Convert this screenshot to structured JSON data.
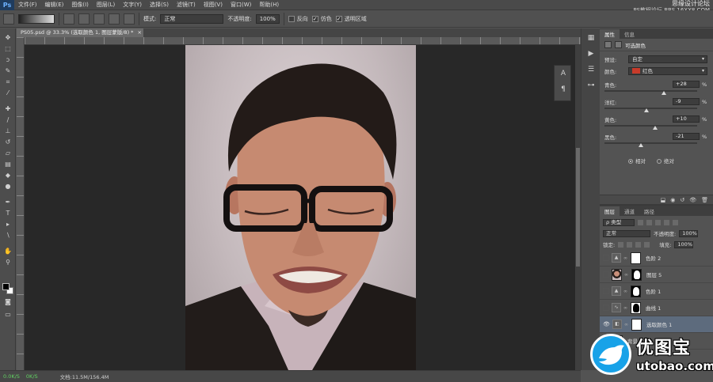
{
  "app": {
    "logo": "Ps"
  },
  "menu": [
    "文件(F)",
    "编辑(E)",
    "图像(I)",
    "图层(L)",
    "文字(Y)",
    "选择(S)",
    "滤镜(T)",
    "视图(V)",
    "窗口(W)",
    "帮助(H)"
  ],
  "watermark_top": {
    "line1": "思缘设计论坛",
    "line2": "PS教程论坛 BBS.16XX8.COM"
  },
  "options": {
    "mode_label": "模式:",
    "mode_value": "正常",
    "opacity_label": "不透明度:",
    "opacity_value": "100%",
    "reverse_label": "反向",
    "dither_label": "仿色",
    "transparency_label": "透明区域",
    "dither_checked": true,
    "transparency_checked": true
  },
  "document": {
    "tab_title": "PS05.psd @ 33.3% (选取颜色 1, 图层蒙版/8) *",
    "close": "×"
  },
  "status": {
    "left": "0.0K/S",
    "mid": "0K/S",
    "doc_info": "文档:11.5M/156.4M"
  },
  "properties": {
    "tabs": [
      "属性",
      "信息"
    ],
    "panel_title": "可选颜色",
    "preset_label": "预设:",
    "preset_value": "自定",
    "colors_label": "颜色:",
    "colors_value": "红色",
    "red_swatch": "#c73b2a",
    "sliders": [
      {
        "label": "青色:",
        "value": "+28",
        "unit": "%",
        "position": 0.64
      },
      {
        "label": "洋红:",
        "value": "-9",
        "unit": "%",
        "position": 0.455
      },
      {
        "label": "黄色:",
        "value": "+10",
        "unit": "%",
        "position": 0.55
      },
      {
        "label": "黑色:",
        "value": "-21",
        "unit": "%",
        "position": 0.395
      }
    ],
    "radio_relative": "相对",
    "radio_absolute": "绝对",
    "relative_selected": true
  },
  "layers": {
    "tabs": [
      "图层",
      "通道",
      "路径"
    ],
    "kind_label": "ρ 类型",
    "blend_mode": "正常",
    "opacity_label": "不透明度:",
    "opacity_value": "100%",
    "lock_label": "锁定:",
    "fill_label": "填充:",
    "fill_value": "100%",
    "items": [
      {
        "name": "色阶 2",
        "visible": false,
        "thumb": "adjustment-levels",
        "mask": "white",
        "active": false
      },
      {
        "name": "图层 5",
        "visible": false,
        "thumb": "photo",
        "mask": "black-figure",
        "active": false
      },
      {
        "name": "色阶 1",
        "visible": false,
        "thumb": "adjustment-levels",
        "mask": "black-figure",
        "active": false
      },
      {
        "name": "曲线 1",
        "visible": false,
        "thumb": "adjustment-curves",
        "mask": "black-white-figure",
        "active": false
      },
      {
        "name": "选取颜色 1",
        "visible": true,
        "thumb": "adjustment-selective",
        "mask": "white",
        "active": true
      },
      {
        "name": "背景",
        "visible": true,
        "thumb": "photo",
        "mask": "none",
        "active": false
      }
    ]
  },
  "watermark_bottom": {
    "title": "优图宝",
    "url": "utobao.com"
  }
}
